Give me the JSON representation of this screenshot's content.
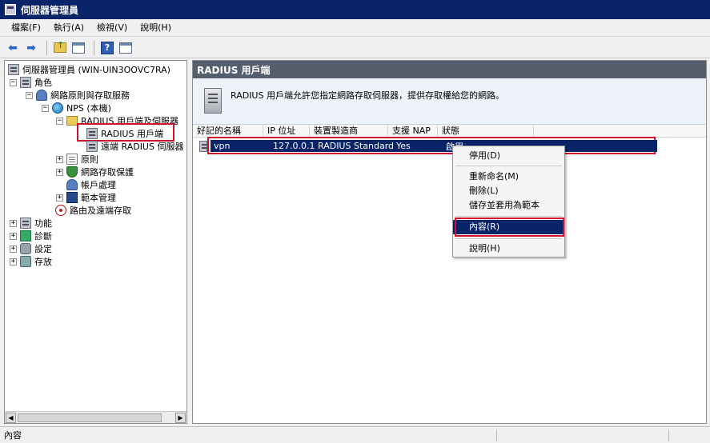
{
  "window": {
    "title": "伺服器管理員"
  },
  "menubar": {
    "items": [
      "檔案(F)",
      "執行(A)",
      "檢視(V)",
      "說明(H)"
    ]
  },
  "toolbar": {
    "buttons": [
      "back-arrow-icon",
      "forward-arrow-icon",
      "folder-up-icon",
      "show-tree-icon",
      "help-icon",
      "properties-icon"
    ]
  },
  "tree": {
    "root": "伺服器管理員 (WIN-UIN3OOVC7RA)",
    "roles": "角色",
    "nps_service": "網路原則與存取服務",
    "nps_local": "NPS (本機)",
    "radius_clients_servers": "RADIUS 用戶端及伺服器",
    "radius_clients": "RADIUS 用戶端",
    "remote_radius_groups": "遠端 RADIUS 伺服器",
    "policies": "原則",
    "nap": "網路存取保護",
    "accounting": "帳戶處理",
    "templates": "範本管理",
    "routing": "路由及遠端存取",
    "features": "功能",
    "diagnostics": "診斷",
    "configuration": "設定",
    "storage": "存放"
  },
  "content": {
    "header": "RADIUS 用戶端",
    "info": "RADIUS 用戶端允許您指定網路存取伺服器，提供存取權給您的網路。",
    "columns": [
      "好記的名稱",
      "IP 位址",
      "裝置製造商",
      "支援 NAP",
      "狀態"
    ],
    "rows": [
      {
        "name": "vpn",
        "ip": "127.0.0.1",
        "vendor": "RADIUS Standard",
        "nap": "Yes",
        "status": "啟用"
      }
    ]
  },
  "context_menu": {
    "disable": "停用(D)",
    "rename": "重新命名(M)",
    "delete": "刪除(L)",
    "save_as_template": "儲存並套用為範本",
    "properties": "內容(R)",
    "help": "說明(H)"
  },
  "statusbar": {
    "text": "內容"
  }
}
